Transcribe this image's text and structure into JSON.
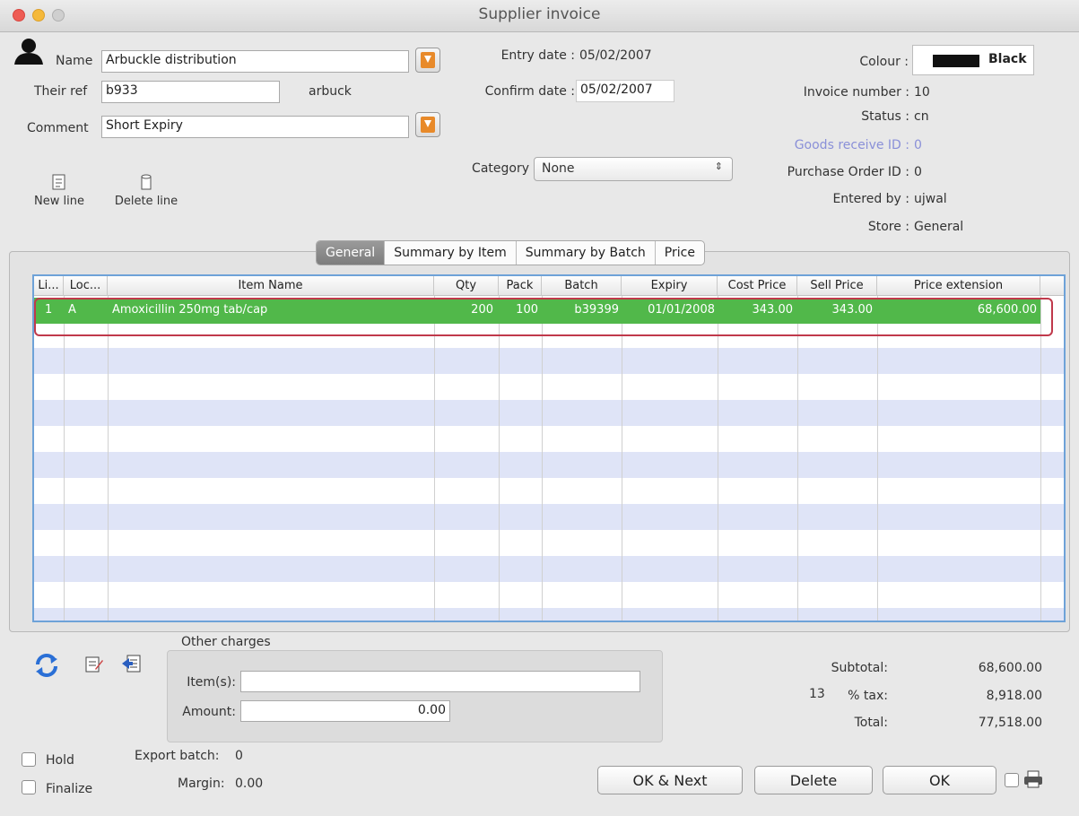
{
  "window": {
    "title": "Supplier invoice"
  },
  "form": {
    "name_label": "Name",
    "name_value": "Arbuckle distribution",
    "their_ref_label": "Their ref",
    "their_ref_value": "b933",
    "supplier_code": "arbuck",
    "comment_label": "Comment",
    "comment_value": "Short Expiry",
    "entry_date_label": "Entry date :",
    "entry_date_value": "05/02/2007",
    "confirm_date_label": "Confirm date :",
    "confirm_date_value": "05/02/2007",
    "category_label": "Category",
    "category_value": "None"
  },
  "info": {
    "colour_label": "Colour :",
    "colour_value": "Black",
    "colour_swatch": "#111111",
    "invoice_number_label": "Invoice number :",
    "invoice_number_value": "10",
    "status_label": "Status :",
    "status_value": "cn",
    "goods_receive_label": "Goods receive ID :",
    "goods_receive_value": "0",
    "purchase_order_label": "Purchase Order ID :",
    "purchase_order_value": "0",
    "entered_by_label": "Entered by :",
    "entered_by_value": "ujwal",
    "store_label": "Store :",
    "store_value": "General"
  },
  "toolbar": {
    "new_line": "New line",
    "delete_line": "Delete line"
  },
  "tabs": [
    "General",
    "Summary by Item",
    "Summary by Batch",
    "Price"
  ],
  "table": {
    "headers": [
      "Li...",
      "Loc...",
      "Item Name",
      "Qty",
      "Pack",
      "Batch",
      "Expiry",
      "Cost Price",
      "Sell Price",
      "Price extension"
    ],
    "rows": [
      [
        "1",
        "A",
        "Amoxicillin 250mg tab/cap",
        "200",
        "100",
        "b39399",
        "01/01/2008",
        "343.00",
        "343.00",
        "68,600.00"
      ]
    ]
  },
  "charges": {
    "title": "Other charges",
    "items_label": "Item(s):",
    "items_value": "",
    "amount_label": "Amount:",
    "amount_value": "0.00"
  },
  "totals": {
    "subtotal_label": "Subtotal:",
    "subtotal_value": "68,600.00",
    "tax_rate": "13",
    "tax_label": "% tax:",
    "tax_value": "8,918.00",
    "total_label": "Total:",
    "total_value": "77,518.00"
  },
  "footer": {
    "hold_label": "Hold",
    "finalize_label": "Finalize",
    "export_batch_label": "Export batch:",
    "export_batch_value": "0",
    "margin_label": "Margin:",
    "margin_value": "0.00",
    "ok_next": "OK & Next",
    "delete": "Delete",
    "ok": "OK"
  },
  "colors": {
    "selected_row": "#51b84a",
    "stripe": "#dfe4f7",
    "highlight_border": "#c0394b",
    "grid_border": "#6ea2d8"
  }
}
